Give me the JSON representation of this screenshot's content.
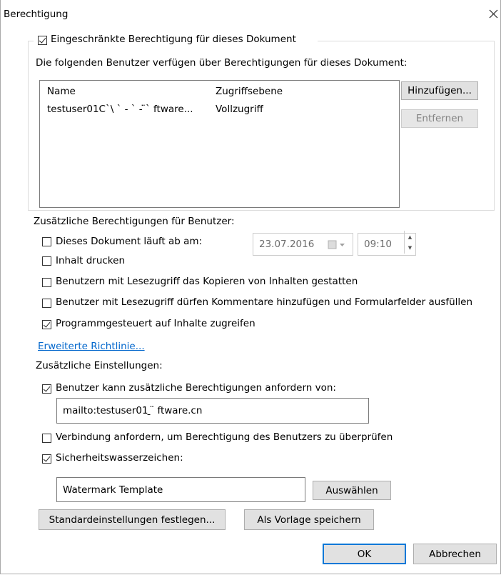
{
  "dialog": {
    "title": "Berechtigung"
  },
  "group": {
    "checkbox_label": "Eingeschränkte Berechtigung für dieses Dokument",
    "checked": true,
    "description": "Die folgenden Benutzer verfügen über Berechtigungen für dieses Dokument:",
    "columns": [
      "Name",
      "Zugriffsebene"
    ],
    "rows": [
      {
        "name": "testuser01C`\\  ` -  ` - ̈` ftware...",
        "access": "Vollzugriff"
      }
    ],
    "add_label": "Hinzufügen...",
    "remove_label": "Entfernen"
  },
  "additional_permissions": {
    "heading": "Zusätzliche Berechtigungen für Benutzer:",
    "expires": {
      "label": "Dieses Dokument läuft ab am:",
      "checked": false,
      "date": "23.07.2016",
      "time": "09:10"
    },
    "print": {
      "label": "Inhalt drucken",
      "checked": false
    },
    "copy": {
      "label": "Benutzern mit Lesezugriff das Kopieren von Inhalten gestatten",
      "checked": false
    },
    "comments": {
      "label": "Benutzer mit Lesezugriff dürfen Kommentare hinzufügen und Formularfelder ausfüllen",
      "checked": false
    },
    "programmatic": {
      "label": "Programmgesteuert auf Inhalte zugreifen",
      "checked": true
    },
    "advanced_link": "Erweiterte Richtlinie..."
  },
  "additional_settings": {
    "heading": "Zusätzliche Einstellungen:",
    "request": {
      "label": "Benutzer kann zusätzliche Berechtigungen anfordern von:",
      "checked": true,
      "value": "mailto:testuser01 ̱            ̈  ftware.cn"
    },
    "verify": {
      "label": "Verbindung anfordern, um Berechtigung des Benutzers zu überprüfen",
      "checked": false
    },
    "watermark": {
      "label": "Sicherheitswasserzeichen:",
      "checked": true,
      "value": "Watermark Template",
      "select_label": "Auswählen"
    }
  },
  "buttons": {
    "set_defaults": "Standardeinstellungen festlegen...",
    "save_template": "Als Vorlage speichern",
    "ok": "OK",
    "cancel": "Abbrechen"
  },
  "colors": {
    "accent": "#0078d7",
    "link": "#0066cc",
    "disabled_text": "#838383"
  },
  "icons": {
    "close": "close-icon",
    "calendar": "calendar-icon",
    "spin_up": "spin-up-icon",
    "spin_down": "spin-down-icon"
  }
}
